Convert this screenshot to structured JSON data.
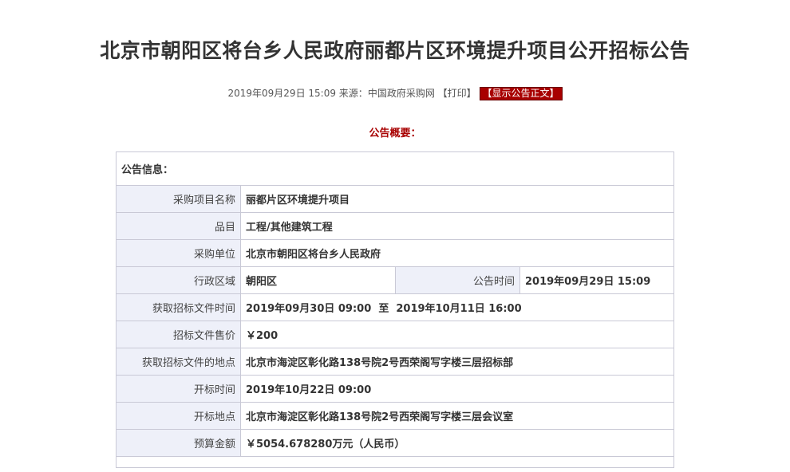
{
  "page": {
    "title": "北京市朝阳区将台乡人民政府丽都片区环境提升项目公开招标公告",
    "meta": {
      "datetime": "2019年09月29日 15:09",
      "source_label": "来源：",
      "source": "中国政府采购网",
      "print_label": "【打印】",
      "show_body_label": "【显示公告正文】"
    },
    "summary_label": "公告概要："
  },
  "info": {
    "section_label": "公告信息：",
    "rows": {
      "project_name": {
        "label": "采购项目名称",
        "value": "丽都片区环境提升项目"
      },
      "category": {
        "label": "品目",
        "value": "工程/其他建筑工程"
      },
      "purchaser": {
        "label": "采购单位",
        "value": "北京市朝阳区将台乡人民政府"
      },
      "region": {
        "label": "行政区域",
        "value": "朝阳区"
      },
      "announce_time": {
        "label": "公告时间",
        "value": "2019年09月29日 15:09"
      },
      "doc_time": {
        "label": "获取招标文件时间",
        "value": "2019年09月30日 09:00  至  2019年10月11日 16:00"
      },
      "doc_price": {
        "label": "招标文件售价",
        "value": "￥200"
      },
      "doc_place": {
        "label": "获取招标文件的地点",
        "value": "北京市海淀区彰化路138号院2号西荣阁写字楼三层招标部"
      },
      "open_time": {
        "label": "开标时间",
        "value": "2019年10月22日 09:00"
      },
      "open_place": {
        "label": "开标地点",
        "value": "北京市海淀区彰化路138号院2号西荣阁写字楼三层会议室"
      },
      "budget": {
        "label": "预算金额",
        "value": "￥5054.678280万元（人民币）"
      }
    }
  }
}
